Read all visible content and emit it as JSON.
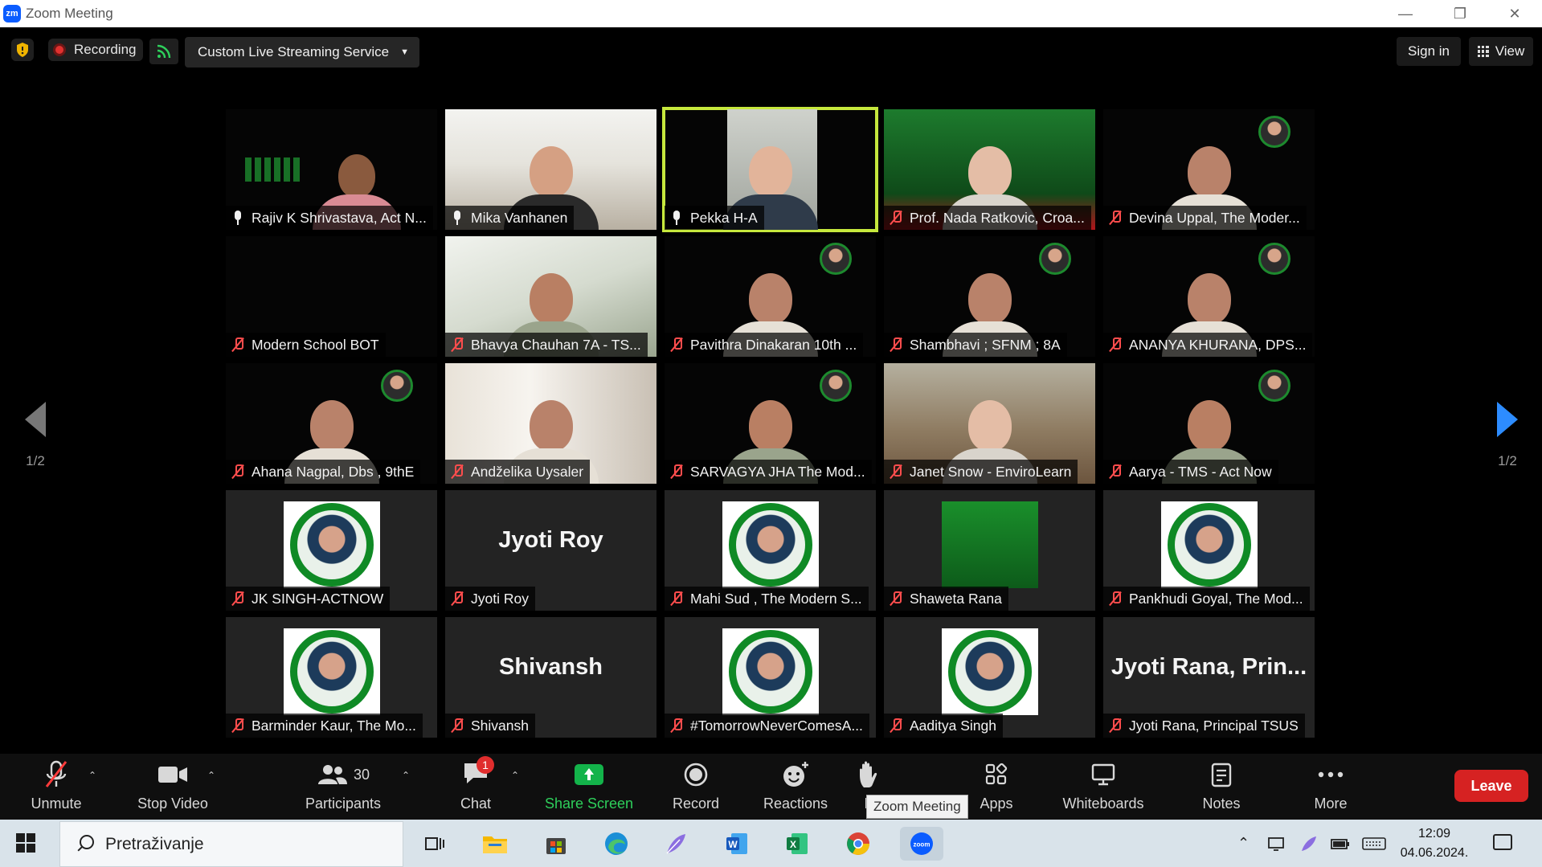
{
  "window": {
    "logo": "zm",
    "title": "Zoom Meeting",
    "controls": [
      "minimize-icon",
      "restore-icon",
      "close-icon"
    ]
  },
  "topbar": {
    "recording_label": "Recording",
    "stream_label": "Custom Live Streaming Service",
    "signin_label": "Sign in",
    "view_label": "View"
  },
  "pager": {
    "left_label": "1/2",
    "right_label": "1/2"
  },
  "tiles": [
    {
      "name": "Rajiv K Shrivastava, Act N...",
      "mic": "on",
      "style": "black",
      "scene": "poster"
    },
    {
      "name": "Mika Vanhanen",
      "mic": "on",
      "style": "room",
      "scene": "man"
    },
    {
      "name": "Pekka H-A",
      "mic": "on",
      "style": "black",
      "scene": "speaker",
      "active": true
    },
    {
      "name": "Prof. Nada Ratkovic, Croa...",
      "mic": "muted",
      "style": "banner",
      "scene": "woman"
    },
    {
      "name": "Devina Uppal, The Moder...",
      "mic": "muted",
      "style": "black",
      "scene": "girl",
      "badge": true
    },
    {
      "name": "Modern School BOT",
      "mic": "muted",
      "style": "black",
      "scene": "none"
    },
    {
      "name": "Bhavya Chauhan 7A - TS...",
      "mic": "muted",
      "style": "room2",
      "scene": "boy"
    },
    {
      "name": "Pavithra Dinakaran 10th ...",
      "mic": "muted",
      "style": "black",
      "scene": "girl",
      "badge": true
    },
    {
      "name": "Shambhavi ; SFNM ; 8A",
      "mic": "muted",
      "style": "black",
      "scene": "girl",
      "badge": true
    },
    {
      "name": "ANANYA KHURANA, DPS...",
      "mic": "muted",
      "style": "black",
      "scene": "girl",
      "badge": true
    },
    {
      "name": "Ahana Nagpal, Dbs , 9thE",
      "mic": "muted",
      "style": "black",
      "scene": "girl",
      "badge": true
    },
    {
      "name": "Andželika Uysaler",
      "mic": "muted",
      "style": "room3",
      "scene": "girl"
    },
    {
      "name": "SARVAGYA JHA The Mod...",
      "mic": "muted",
      "style": "black",
      "scene": "boy",
      "badge": true
    },
    {
      "name": "Janet Snow - EnviroLearn",
      "mic": "muted",
      "style": "room4",
      "scene": "woman"
    },
    {
      "name": "Aarya - TMS - Act Now",
      "mic": "muted",
      "style": "black",
      "scene": "boy",
      "badge": true
    },
    {
      "name": "JK SINGH-ACTNOW",
      "mic": "muted",
      "style": "gray",
      "scene": "profile"
    },
    {
      "name": "Jyoti Roy",
      "mic": "muted",
      "style": "gray",
      "scene": "text",
      "big": "Jyoti Roy"
    },
    {
      "name": "Mahi Sud , The Modern S...",
      "mic": "muted",
      "style": "gray",
      "scene": "profile"
    },
    {
      "name": "Shaweta Rana",
      "mic": "muted",
      "style": "gray",
      "scene": "poster2"
    },
    {
      "name": "Pankhudi Goyal, The Mod...",
      "mic": "muted",
      "style": "gray",
      "scene": "profile"
    },
    {
      "name": "Barminder Kaur, The Mo...",
      "mic": "muted",
      "style": "gray",
      "scene": "profile"
    },
    {
      "name": "Shivansh",
      "mic": "muted",
      "style": "gray",
      "scene": "text",
      "big": "Shivansh"
    },
    {
      "name": "#TomorrowNeverComesA...",
      "mic": "muted",
      "style": "gray",
      "scene": "profile"
    },
    {
      "name": "Aaditya Singh",
      "mic": "muted",
      "style": "gray",
      "scene": "profile"
    },
    {
      "name": "Jyoti Rana, Principal TSUS",
      "mic": "muted",
      "style": "gray",
      "scene": "text",
      "big": "Jyoti Rana, Prin..."
    }
  ],
  "toolbar": {
    "unmute": "Unmute",
    "stop_video": "Stop Video",
    "participants_count": "30",
    "participants": "Participants",
    "chat": "Chat",
    "chat_badge": "1",
    "share_screen": "Share Screen",
    "record": "Record",
    "reactions": "Reactions",
    "raise_partial": "R",
    "apps": "Apps",
    "whiteboards": "Whiteboards",
    "notes": "Notes",
    "more": "More",
    "leave": "Leave",
    "tooltip": "Zoom Meeting"
  },
  "taskbar": {
    "search_placeholder": "Pretraživanje",
    "time": "12:09",
    "date": "04.06.2024."
  },
  "colors": {
    "active_speaker": "#c6e83d",
    "leave": "#d62222",
    "share": "#13b34a",
    "pager_active": "#2d8cff"
  }
}
